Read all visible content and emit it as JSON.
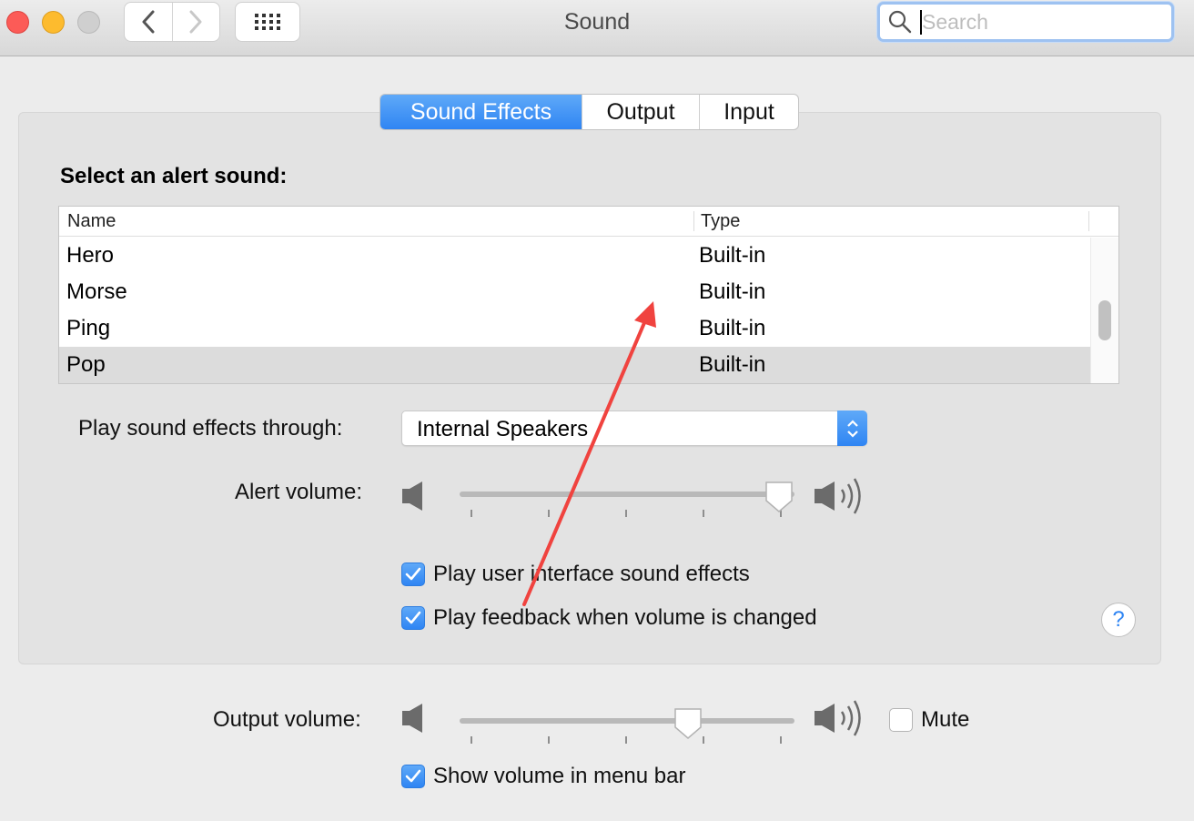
{
  "window": {
    "title": "Sound"
  },
  "search": {
    "placeholder": "Search",
    "value": ""
  },
  "tabs": [
    {
      "label": "Sound Effects",
      "active": true
    },
    {
      "label": "Output",
      "active": false
    },
    {
      "label": "Input",
      "active": false
    }
  ],
  "alert_section": {
    "heading": "Select an alert sound:",
    "columns": {
      "name": "Name",
      "type": "Type"
    },
    "rows": [
      {
        "name": "Hero",
        "type": "Built-in",
        "selected": false
      },
      {
        "name": "Morse",
        "type": "Built-in",
        "selected": false
      },
      {
        "name": "Ping",
        "type": "Built-in",
        "selected": false
      },
      {
        "name": "Pop",
        "type": "Built-in",
        "selected": true
      }
    ]
  },
  "play_through": {
    "label": "Play sound effects through:",
    "value": "Internal Speakers"
  },
  "alert_volume": {
    "label": "Alert volume:",
    "level": 1.0
  },
  "checkboxes": {
    "ui_effects": {
      "label": "Play user interface sound effects",
      "checked": true
    },
    "feedback": {
      "label": "Play feedback when volume is changed",
      "checked": true
    },
    "show_volume": {
      "label": "Show volume in menu bar",
      "checked": true
    }
  },
  "output_volume": {
    "label": "Output volume:",
    "level": 0.7,
    "mute_label": "Mute",
    "muted": false
  },
  "help": {
    "label": "?"
  },
  "colors": {
    "accent": "#2f85f3",
    "annotation_arrow": "#f0433f"
  }
}
